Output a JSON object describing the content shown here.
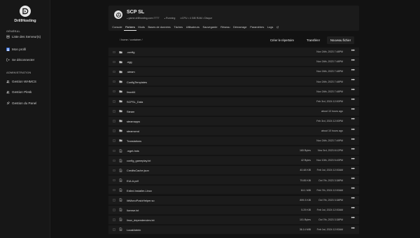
{
  "brand": {
    "name": "DrillHosting",
    "logo_icon": "drill-d-logo"
  },
  "sidebar": {
    "section_general": "GÉNÉRAL",
    "section_admin": "ADMINISTRATION",
    "items": [
      {
        "label": "Liste des Serveur(s)",
        "icon": "server-icon"
      },
      {
        "label": "Mon profil",
        "icon": "user-icon"
      },
      {
        "label": "Se déconnecter",
        "icon": "logout-icon"
      },
      {
        "label": "Gestion WHMCS",
        "icon": "users-icon"
      },
      {
        "label": "Gestion Plesk",
        "icon": "users-icon"
      },
      {
        "label": "Gestion du Panel",
        "icon": "tools-icon"
      }
    ]
  },
  "server": {
    "title": "SCP SL",
    "address": "game.drillhosting.com:7777",
    "status": "Running",
    "resources": "∞CPU • 4 GiB RAM • Disque"
  },
  "tabs": [
    "Console",
    "Fichiers",
    "Mods",
    "Bases de données",
    "Tâches",
    "Utilisateurs",
    "Sauvegarde",
    "Réseau",
    "Démarrage",
    "Paramètres",
    "Logs"
  ],
  "active_tab": "Fichiers",
  "toolbar": {
    "path": "/ home / container /",
    "create_dir": "Créer le répertoire",
    "upload": "Transférer",
    "new_file": "Nouveau fichier"
  },
  "files": [
    {
      "type": "folder",
      "name": ".config",
      "size": "",
      "date": "Nov 24th, 2023 7:48PM"
    },
    {
      "type": "folder",
      "name": ".egg",
      "size": "",
      "date": "Nov 24th, 2023 7:48PM"
    },
    {
      "type": "folder",
      "name": ".steam",
      "size": "",
      "date": "Nov 24th, 2023 7:48PM"
    },
    {
      "type": "folder",
      "name": "ConfigTemplates",
      "size": "",
      "date": "Nov 24th, 2023 7:48PM"
    },
    {
      "type": "folder",
      "name": "linux64",
      "size": "",
      "date": "Nov 24th, 2023 7:48PM"
    },
    {
      "type": "folder",
      "name": "SCPSL_Data",
      "size": "",
      "date": "Feb 3rd, 2024 12:00PM"
    },
    {
      "type": "folder",
      "name": "Steam",
      "size": "",
      "date": "about 10 hours ago"
    },
    {
      "type": "folder",
      "name": "steamapps",
      "size": "",
      "date": "Feb 3rd, 2024 12:00PM"
    },
    {
      "type": "folder",
      "name": "steamcmd",
      "size": "",
      "date": "about 10 hours ago"
    },
    {
      "type": "folder",
      "name": "Translations",
      "size": "",
      "date": "Nov 24th, 2023 7:49PM"
    },
    {
      "type": "file",
      "name": ".wget-hsts",
      "size": "165 Bytes",
      "date": "Nov 3rd, 2023 8:12PM"
    },
    {
      "type": "file",
      "name": "config_gameplay.txt",
      "size": "42 Bytes",
      "date": "Nov 10th, 2023 5:43PM"
    },
    {
      "type": "file",
      "name": "CreditsCache.json",
      "size": "40.48 KiB",
      "date": "Feb 1st, 2024 12:00AM"
    },
    {
      "type": "file",
      "name": "EULA.pdf",
      "size": "79.85 KiB",
      "date": "Oct 7th, 2023 3:38PM"
    },
    {
      "type": "file",
      "name": "Exiled.Installer-Linux",
      "size": "64.1 MiB",
      "date": "Feb 7th, 2024 12:00AM"
    },
    {
      "type": "file",
      "name": "libMonoPosixHelper.so",
      "size": "899.3 KiB",
      "date": "Oct 7th, 2023 3:38PM"
    },
    {
      "type": "file",
      "name": "license.txt",
      "size": "5.29 KiB",
      "date": "Feb 1st, 2024 12:00AM"
    },
    {
      "type": "file",
      "name": "linux_dependencies.txt",
      "size": "101 Bytes",
      "date": "Oct 7th, 2023 3:38PM"
    },
    {
      "type": "file",
      "name": "LocalAdmin",
      "size": "36.14 MiB",
      "date": "Feb 1st, 2024 12:00AM"
    }
  ],
  "colors": {
    "background": "#121212",
    "panel": "#1b1b1b",
    "accent": "#3a6fd8",
    "running": "#c8c8c8"
  }
}
